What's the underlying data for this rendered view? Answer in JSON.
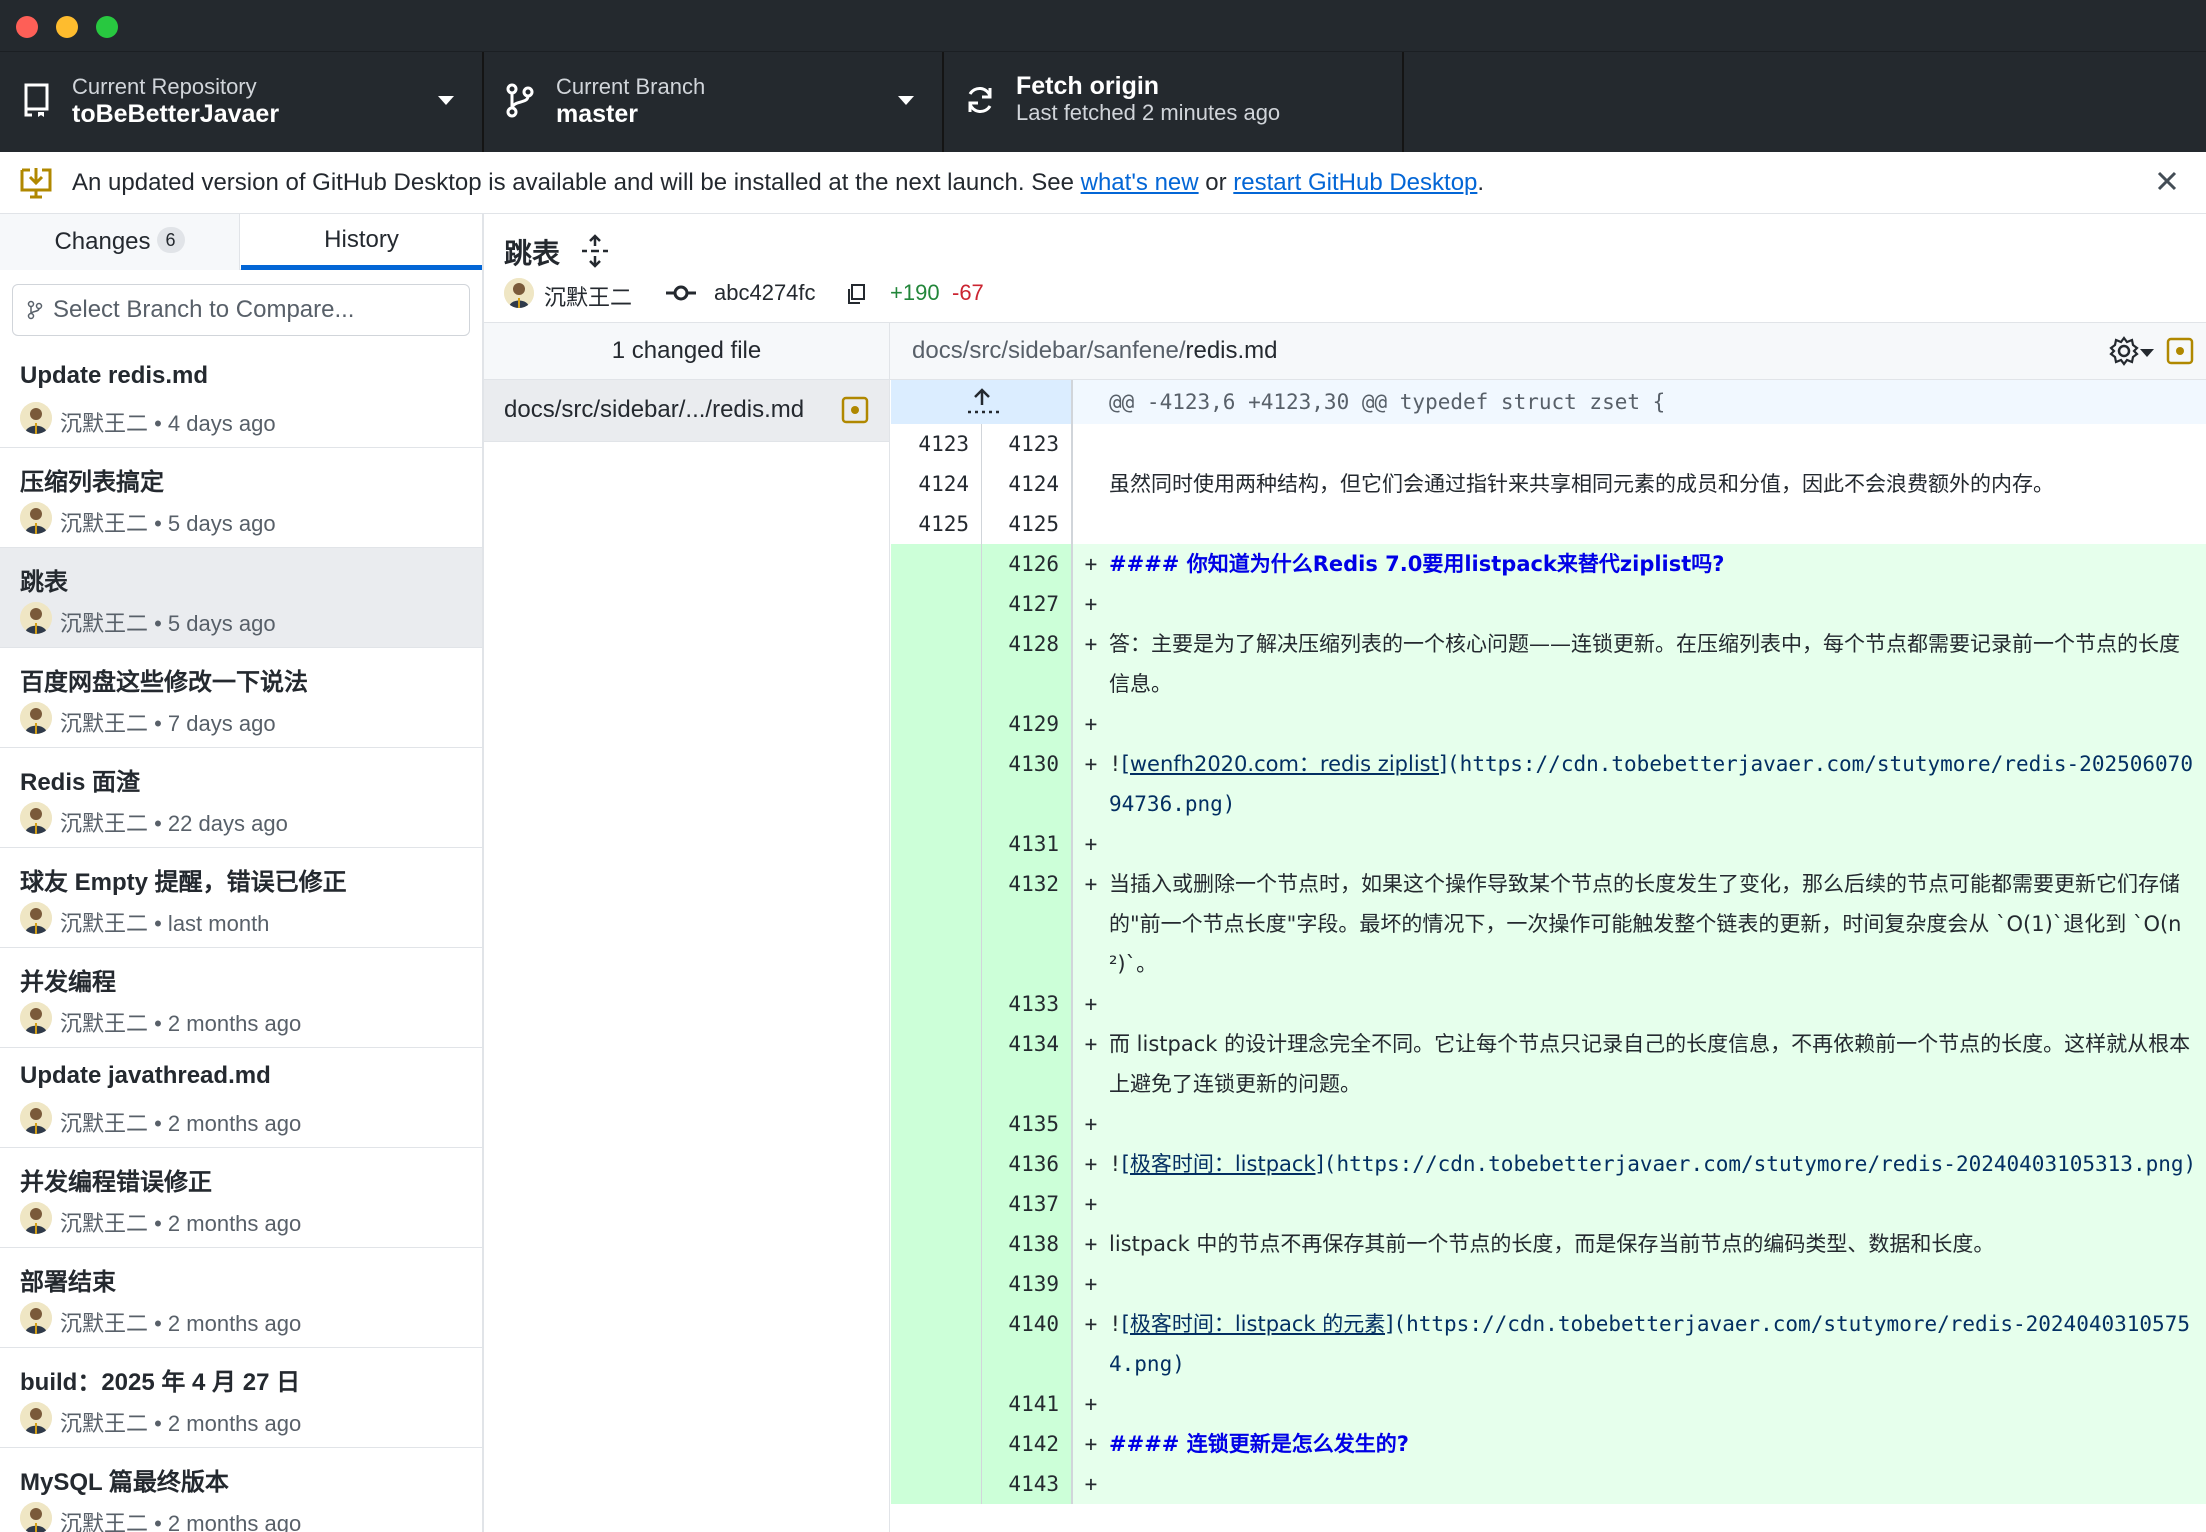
{
  "toolbar": {
    "repo_sub": "Current Repository",
    "repo_name": "toBeBetterJavaer",
    "branch_sub": "Current Branch",
    "branch_name": "master",
    "fetch_main": "Fetch origin",
    "fetch_sub": "Last fetched 2 minutes ago"
  },
  "banner": {
    "text": "An updated version of GitHub Desktop is available and will be installed at the next launch. See",
    "link1": "what's new",
    "or": "or",
    "link2": "restart GitHub Desktop",
    "period": "."
  },
  "tabs": {
    "changes": "Changes",
    "changes_count": "6",
    "history": "History"
  },
  "compare": {
    "placeholder": "Select Branch to Compare..."
  },
  "commits": [
    {
      "title": "Update redis.md",
      "meta": "沉默王二 • 4 days ago"
    },
    {
      "title": "压缩列表搞定",
      "meta": "沉默王二 • 5 days ago"
    },
    {
      "title": "跳表",
      "meta": "沉默王二 • 5 days ago"
    },
    {
      "title": "百度网盘这些修改一下说法",
      "meta": "沉默王二 • 7 days ago"
    },
    {
      "title": "Redis 面渣",
      "meta": "沉默王二 • 22 days ago"
    },
    {
      "title": "球友 Empty 提醒，错误已修正",
      "meta": "沉默王二 • last month"
    },
    {
      "title": "并发编程",
      "meta": "沉默王二 • 2 months ago"
    },
    {
      "title": "Update javathread.md",
      "meta": "沉默王二 • 2 months ago"
    },
    {
      "title": "并发编程错误修正",
      "meta": "沉默王二 • 2 months ago"
    },
    {
      "title": "部署结束",
      "meta": "沉默王二 • 2 months ago"
    },
    {
      "title": "build：2025 年 4 月 27 日",
      "meta": "沉默王二 • 2 months ago"
    },
    {
      "title": "MySQL 篇最终版本",
      "meta": "沉默王二 • 2 months ago"
    }
  ],
  "selected_commit": {
    "summary": "跳表",
    "author": "沉默王二",
    "sha": "abc4274fc",
    "additions": "+190",
    "deletions": "-67"
  },
  "files": {
    "header": "1 changed file",
    "path_prefix": "docs/src/sidebar/sanfene/",
    "path_file": "redis.md",
    "list_item": "docs/src/sidebar/.../redis.md"
  },
  "diff": {
    "hunk_header": "@@ -4123,6 +4123,30 @@ typedef struct zset {",
    "lines": [
      {
        "old": "4123",
        "new": "4123",
        "mark": "",
        "text": ""
      },
      {
        "old": "4124",
        "new": "4124",
        "mark": "",
        "text": "虽然同时使用两种结构，但它们会通过指针来共享相同元素的成员和分值，因此不会浪费额外的内存。"
      },
      {
        "old": "4125",
        "new": "4125",
        "mark": "",
        "text": ""
      },
      {
        "old": "",
        "new": "4126",
        "mark": "+",
        "text": "#### 你知道为什么Redis 7.0要用listpack来替代ziplist吗?"
      },
      {
        "old": "",
        "new": "4127",
        "mark": "+",
        "text": ""
      },
      {
        "old": "",
        "new": "4128",
        "mark": "+",
        "text": "答：主要是为了解决压缩列表的一个核心问题——连锁更新。在压缩列表中，每个节点都需要记录前一个节点的长度信息。"
      },
      {
        "old": "",
        "new": "4129",
        "mark": "+",
        "text": ""
      },
      {
        "old": "",
        "new": "4130",
        "mark": "+",
        "text_link": "[wenfh2020.com：redis ziplist]",
        "text_rest": "(https://cdn.tobebetterjavaer.com/stutymore/redis-20250607094736.png)"
      },
      {
        "old": "",
        "new": "4131",
        "mark": "+",
        "text": ""
      },
      {
        "old": "",
        "new": "4132",
        "mark": "+",
        "text": "当插入或删除一个节点时，如果这个操作导致某个节点的长度发生了变化，那么后续的节点可能都需要更新它们存储的\"前一个节点长度\"字段。最坏的情况下，一次操作可能触发整个链表的更新，时间复杂度会从 `O(1)`退化到 `O(n²)`。"
      },
      {
        "old": "",
        "new": "4133",
        "mark": "+",
        "text": ""
      },
      {
        "old": "",
        "new": "4134",
        "mark": "+",
        "text": "而 listpack 的设计理念完全不同。它让每个节点只记录自己的长度信息，不再依赖前一个节点的长度。这样就从根本上避免了连锁更新的问题。"
      },
      {
        "old": "",
        "new": "4135",
        "mark": "+",
        "text": ""
      },
      {
        "old": "",
        "new": "4136",
        "mark": "+",
        "text_link": "[极客时间：listpack]",
        "text_rest": "(https://cdn.tobebetterjavaer.com/stutymore/redis-20240403105313.png)"
      },
      {
        "old": "",
        "new": "4137",
        "mark": "+",
        "text": ""
      },
      {
        "old": "",
        "new": "4138",
        "mark": "+",
        "text": "listpack 中的节点不再保存其前一个节点的长度，而是保存当前节点的编码类型、数据和长度。"
      },
      {
        "old": "",
        "new": "4139",
        "mark": "+",
        "text": ""
      },
      {
        "old": "",
        "new": "4140",
        "mark": "+",
        "text_link": "[极客时间：listpack 的元素]",
        "text_rest": "(https://cdn.tobebetterjavaer.com/stutymore/redis-20240403105754.png)"
      },
      {
        "old": "",
        "new": "4141",
        "mark": "+",
        "text": ""
      },
      {
        "old": "",
        "new": "4142",
        "mark": "+",
        "text": "#### 连锁更新是怎么发生的?"
      },
      {
        "old": "",
        "new": "4143",
        "mark": "+",
        "text": ""
      }
    ]
  },
  "colors": {
    "accent": "#0366d6",
    "added_bg": "#e6ffec",
    "added_gutter": "#ccffd8",
    "toolbar_bg": "#24292e",
    "modified_icon": "#b08800"
  },
  "icons": [
    "repo-icon",
    "branch-icon",
    "sync-icon",
    "desktop-download-icon",
    "close-icon",
    "git-branch-small-icon",
    "expand-icon",
    "git-commit-icon",
    "copy-icon",
    "gear-icon",
    "file-modified-icon",
    "fold-up-icon"
  ]
}
